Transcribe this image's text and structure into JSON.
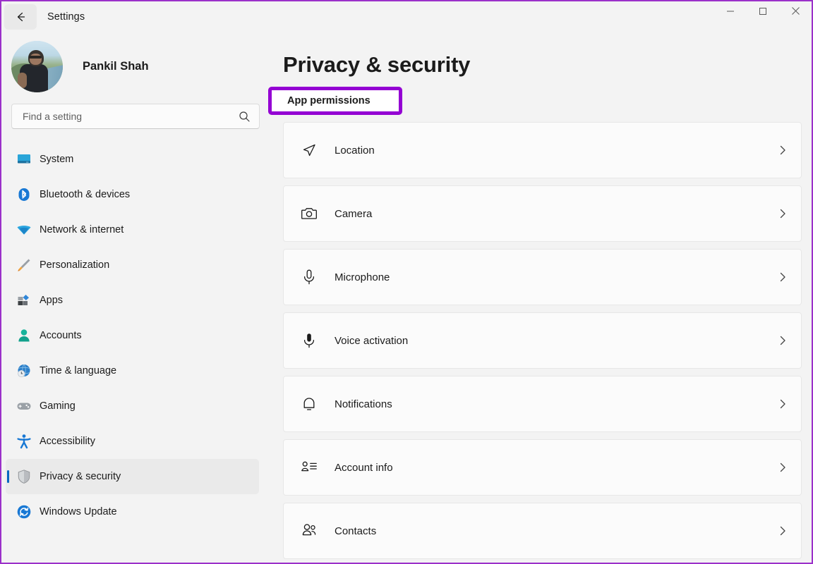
{
  "window": {
    "title": "Settings",
    "back_icon": "back-arrow-icon",
    "controls": {
      "minimize": "minimize-icon",
      "maximize": "maximize-icon",
      "close": "close-icon"
    }
  },
  "sidebar": {
    "profile": {
      "name": "Pankil Shah",
      "avatar": "user-avatar"
    },
    "search": {
      "placeholder": "Find a setting",
      "value": "",
      "icon": "search-icon"
    },
    "items": [
      {
        "label": "System",
        "icon": "monitor-icon",
        "selected": false
      },
      {
        "label": "Bluetooth & devices",
        "icon": "bluetooth-icon",
        "selected": false
      },
      {
        "label": "Network & internet",
        "icon": "wifi-icon",
        "selected": false
      },
      {
        "label": "Personalization",
        "icon": "paintbrush-icon",
        "selected": false
      },
      {
        "label": "Apps",
        "icon": "apps-icon",
        "selected": false
      },
      {
        "label": "Accounts",
        "icon": "person-icon",
        "selected": false
      },
      {
        "label": "Time & language",
        "icon": "clock-globe-icon",
        "selected": false
      },
      {
        "label": "Gaming",
        "icon": "gamepad-icon",
        "selected": false
      },
      {
        "label": "Accessibility",
        "icon": "accessibility-icon",
        "selected": false
      },
      {
        "label": "Privacy & security",
        "icon": "shield-icon",
        "selected": true
      },
      {
        "label": "Windows Update",
        "icon": "update-sync-icon",
        "selected": false
      }
    ]
  },
  "main": {
    "page_title": "Privacy & security",
    "section_header": "App permissions",
    "permissions": [
      {
        "label": "Location",
        "icon": "location-arrow-icon"
      },
      {
        "label": "Camera",
        "icon": "camera-icon"
      },
      {
        "label": "Microphone",
        "icon": "microphone-icon"
      },
      {
        "label": "Voice activation",
        "icon": "voice-activation-icon"
      },
      {
        "label": "Notifications",
        "icon": "bell-icon"
      },
      {
        "label": "Account info",
        "icon": "account-info-icon"
      },
      {
        "label": "Contacts",
        "icon": "contacts-icon"
      }
    ]
  },
  "colors": {
    "accent_blue": "#0067c0",
    "highlight_purple": "#9400d3",
    "window_background": "#f3f3f3",
    "card_background": "#fbfbfb"
  }
}
